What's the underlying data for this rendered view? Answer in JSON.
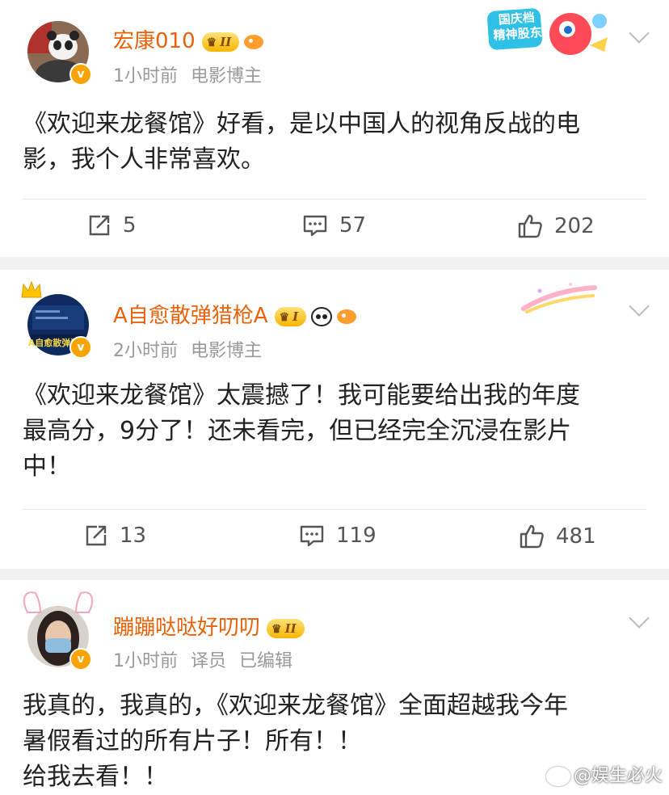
{
  "posts": [
    {
      "username": "宏康010",
      "level": "II",
      "time": "1小时前",
      "tag": "电影博主",
      "content": [
        "《欢迎来龙餐馆》好看，是以中国人的视角反战的电",
        "影，我个人非常喜欢。"
      ],
      "decor_text": [
        "国庆档",
        "精神股东"
      ],
      "reposts": "5",
      "comments": "57",
      "likes": "202"
    },
    {
      "username": "A自愈散弹猎枪A",
      "level": "I",
      "time": "2小时前",
      "tag": "电影博主",
      "content": [
        "《欢迎来龙餐馆》太震撼了！我可能要给出我的年度",
        "最高分，9分了！还未看完，但已经完全沉浸在影片",
        "中！"
      ],
      "avatar_text": "A自愈散弹猎枪",
      "reposts": "13",
      "comments": "119",
      "likes": "481"
    },
    {
      "username": "蹦蹦哒哒好叨叨",
      "level": "II",
      "time": "1小时前",
      "tag": "译员",
      "edited": "已编辑",
      "content": [
        "我真的，我真的，《欢迎来龙餐馆》全面超越我今年",
        "暑假看过的所有片子！所有！！",
        "给我去看！！"
      ]
    }
  ],
  "verified_badge": "v",
  "watermark": "@娱生必火",
  "colors": {
    "username": "#e8620a",
    "meta": "#999999",
    "badge": "#f7a300",
    "background": "#f1f1f1"
  },
  "icons": [
    "repost-icon",
    "comment-icon",
    "like-icon",
    "chevron-down-icon",
    "verified-badge-icon",
    "weibo-logo-icon"
  ]
}
